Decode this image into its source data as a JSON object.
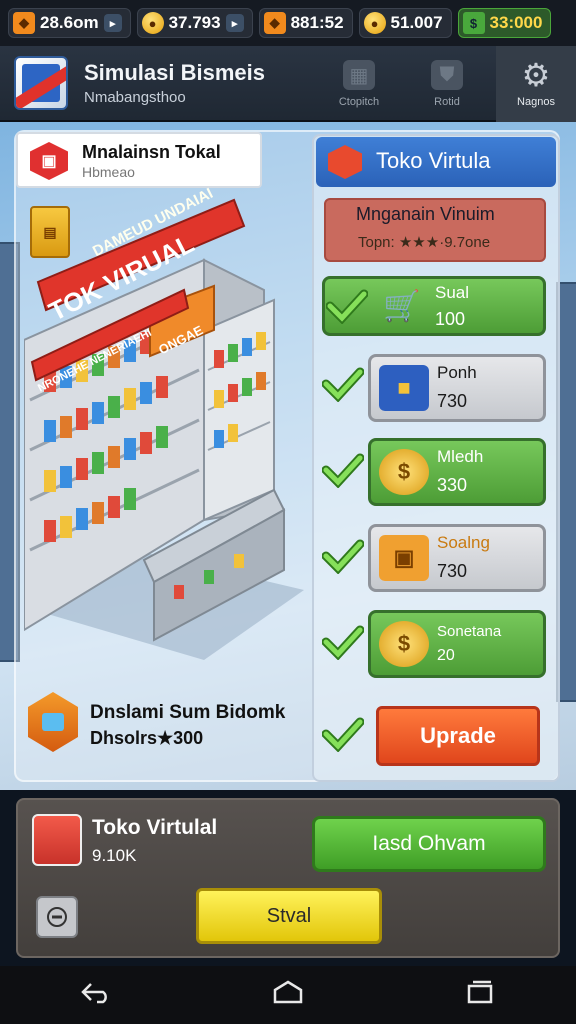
{
  "status_bar": {
    "gems": "28.6om",
    "coins": "37.793",
    "resource": "881:52",
    "gold": "51.007",
    "cash": "33:000"
  },
  "header": {
    "title": "Simulasi Bismeis",
    "subtitle": "Nmabangsthoo",
    "tabs": [
      {
        "label": "Ctopitch",
        "icon": "store-icon"
      },
      {
        "label": "Rotid",
        "icon": "shield-icon"
      },
      {
        "label": "Nagnos",
        "icon": "gear-icon"
      }
    ]
  },
  "shop_card": {
    "name": "Mnalainsn Tokal",
    "subtitle": "Hbmeao"
  },
  "store_sign": {
    "line1": "TOK VIRUAL",
    "line2": "DAMEUD UNDAIAI",
    "shelf_banner": "NRONEHE NENERIAEHI",
    "box_label": "ONGAE"
  },
  "stats": {
    "title": "Dnslami Sum Bidomk",
    "value": "Dhsolrs★300"
  },
  "right_panel": {
    "title": "Toko Virtula",
    "rating": {
      "title": "Mnganain Vinuim",
      "subtitle": "Topn: ★★★·9.7one"
    },
    "items": [
      {
        "label": "Sual",
        "value": "100",
        "style": "green"
      },
      {
        "label": "Ponh",
        "value": "730",
        "style": "grey"
      },
      {
        "label": "Mledh",
        "value": "330",
        "style": "green"
      },
      {
        "label": "Soalng",
        "value": "730",
        "style": "grey"
      },
      {
        "label": "Sonetana",
        "value": "20",
        "style": "green"
      }
    ],
    "upgrade_label": "Uprade"
  },
  "bottom_panel": {
    "title": "Toko Virtulal",
    "value": "9.10K",
    "green_button": "Iasd Ohvam",
    "yellow_button": "Stval"
  },
  "nav": {
    "back": "back-icon",
    "home": "home-icon",
    "recents": "recents-icon"
  },
  "colors": {
    "accent_green": "#4d9d36",
    "accent_orange": "#e0461c",
    "accent_yellow": "#e2c60a",
    "header_blue": "#2b62b8"
  }
}
